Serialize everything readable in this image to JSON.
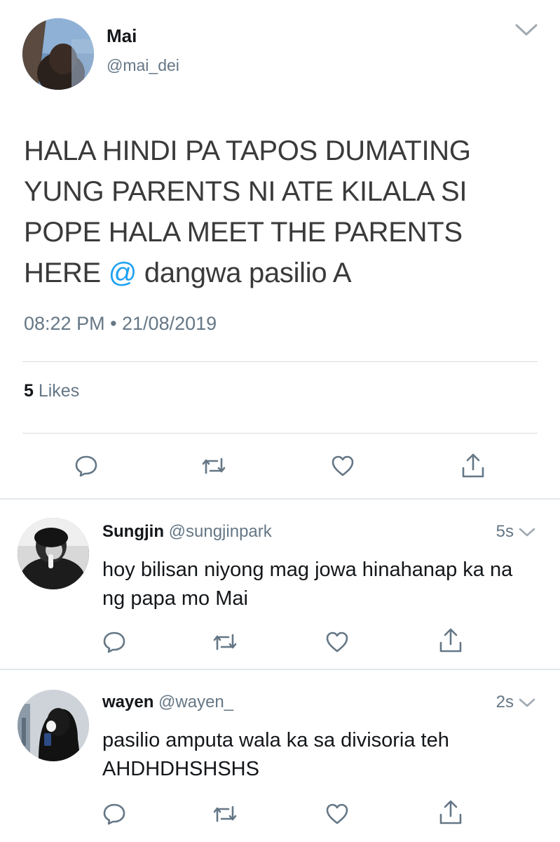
{
  "main_tweet": {
    "display_name": "Mai",
    "handle": "@mai_dei",
    "text_before_at": "HALA HINDI PA TAPOS DUMATING YUNG PARENTS NI ATE KILALA SI POPE HALA MEET THE PARENTS HERE ",
    "at_symbol": "@",
    "text_after_at": " dangwa pasilio A",
    "timestamp": "08:22 PM • 21/08/2019",
    "likes_count": "5",
    "likes_label": " Likes",
    "icons": [
      "reply-icon",
      "retweet-icon",
      "like-icon",
      "share-icon",
      "chevron-down-icon"
    ]
  },
  "replies": [
    {
      "display_name": "Sungjin",
      "handle": " @sungjinpark",
      "time": "5s",
      "text": "hoy bilisan niyong mag jowa hinahanap ka na ng papa mo Mai"
    },
    {
      "display_name": "wayen",
      "handle": " @wayen_",
      "time": "2s",
      "text": "pasilio amputa wala ka sa divisoria teh AHDHDHSHSHS"
    }
  ],
  "colors": {
    "link": "#1da1f2",
    "secondary_text": "#657786",
    "icon": "#657786"
  }
}
